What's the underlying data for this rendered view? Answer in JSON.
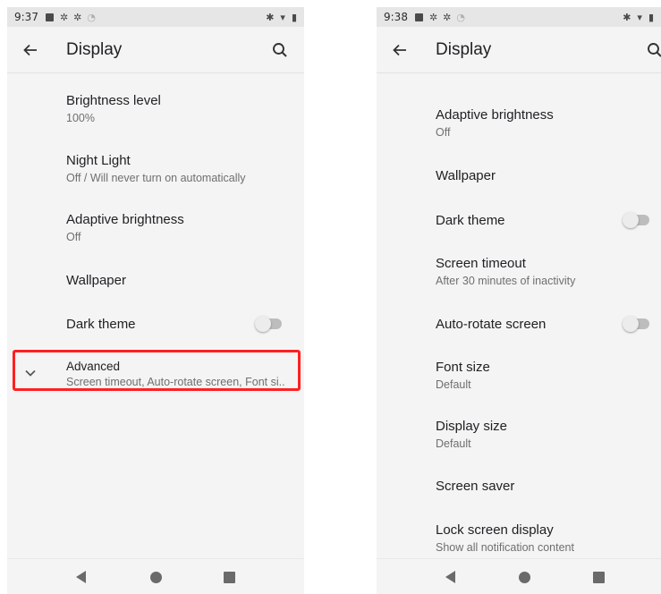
{
  "colors": {
    "highlight": "#ff2020",
    "background": "#f4f4f4",
    "status_bar": "#e6e6e6"
  },
  "left": {
    "status": {
      "time": "9:37"
    },
    "toolbar": {
      "title": "Display"
    },
    "items": [
      {
        "title": "Brightness level",
        "summary": "100%"
      },
      {
        "title": "Night Light",
        "summary": "Off / Will never turn on automatically"
      },
      {
        "title": "Adaptive brightness",
        "summary": "Off"
      },
      {
        "title": "Wallpaper"
      },
      {
        "title": "Dark theme",
        "toggle": "off"
      },
      {
        "title": "Advanced",
        "summary": "Screen timeout, Auto-rotate screen, Font si.."
      }
    ]
  },
  "right": {
    "status": {
      "time": "9:38"
    },
    "toolbar": {
      "title": "Display"
    },
    "items": [
      {
        "title": "Adaptive brightness",
        "summary": "Off"
      },
      {
        "title": "Wallpaper"
      },
      {
        "title": "Dark theme",
        "toggle": "off"
      },
      {
        "title": "Screen timeout",
        "summary": "After 30 minutes of inactivity"
      },
      {
        "title": "Auto-rotate screen",
        "toggle": "off"
      },
      {
        "title": "Font size",
        "summary": "Default"
      },
      {
        "title": "Display size",
        "summary": "Default"
      },
      {
        "title": "Screen saver"
      },
      {
        "title": "Lock screen display",
        "summary": "Show all notification content"
      }
    ]
  }
}
